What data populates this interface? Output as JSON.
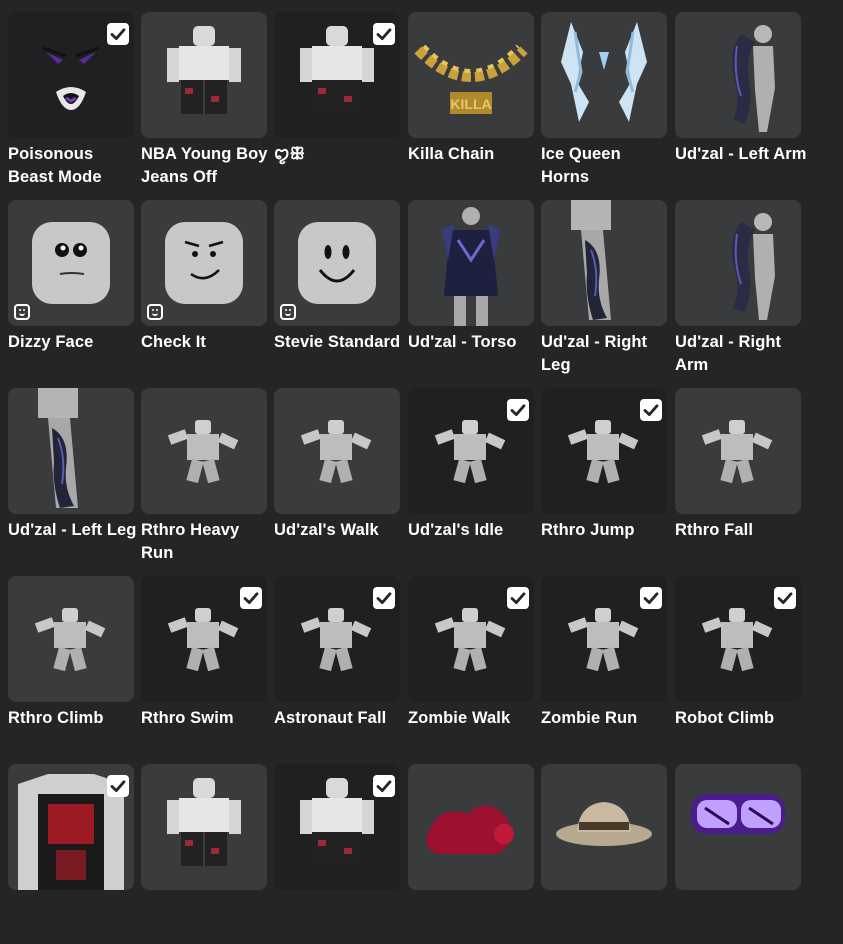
{
  "colors": {
    "page_bg": "#232527",
    "tile_bg": "#393b3d",
    "tile_dark_bg": "#1f2022",
    "text": "#ffffff",
    "check_bg": "#ffffff",
    "check_mark": "#232527"
  },
  "items": [
    {
      "name": "Poisonous Beast Mode",
      "selected": true,
      "badge": false,
      "dark": true,
      "art": "beast-face-icon"
    },
    {
      "name": "NBA Young Boy Jeans Off",
      "selected": false,
      "badge": false,
      "dark": false,
      "art": "avatar-pants-icon"
    },
    {
      "name": "ꨄ︎ꕥ",
      "selected": true,
      "badge": false,
      "dark": true,
      "art": "avatar-pants-icon"
    },
    {
      "name": "Killa Chain",
      "selected": false,
      "badge": false,
      "dark": false,
      "art": "gold-chain-icon"
    },
    {
      "name": "Ice Queen Horns",
      "selected": false,
      "badge": false,
      "dark": false,
      "art": "ice-horns-icon"
    },
    {
      "name": "Ud'zal - Left Arm",
      "selected": false,
      "badge": false,
      "dark": false,
      "art": "mannequin-arm-icon"
    },
    {
      "name": "Dizzy Face",
      "selected": false,
      "badge": true,
      "dark": false,
      "art": "face-dizzy-icon"
    },
    {
      "name": "Check It",
      "selected": false,
      "badge": true,
      "dark": false,
      "art": "face-smirk-icon"
    },
    {
      "name": "Stevie Standard",
      "selected": false,
      "badge": true,
      "dark": false,
      "art": "face-smile-icon"
    },
    {
      "name": "Ud'zal - Torso",
      "selected": false,
      "badge": false,
      "dark": false,
      "art": "armored-torso-icon"
    },
    {
      "name": "Ud'zal - Right Leg",
      "selected": false,
      "badge": false,
      "dark": false,
      "art": "mannequin-leg-icon"
    },
    {
      "name": "Ud'zal - Right Arm",
      "selected": false,
      "badge": false,
      "dark": false,
      "art": "mannequin-arm-icon"
    },
    {
      "name": "Ud'zal - Left Leg",
      "selected": false,
      "badge": false,
      "dark": false,
      "art": "mannequin-leg-icon"
    },
    {
      "name": "Rthro Heavy Run",
      "selected": false,
      "badge": false,
      "dark": false,
      "art": "animation-figure-icon"
    },
    {
      "name": "Ud'zal's Walk",
      "selected": false,
      "badge": false,
      "dark": false,
      "art": "animation-figure-icon"
    },
    {
      "name": "Ud'zal's Idle",
      "selected": true,
      "badge": false,
      "dark": true,
      "art": "animation-figure-icon"
    },
    {
      "name": "Rthro Jump",
      "selected": true,
      "badge": false,
      "dark": true,
      "art": "animation-figure-icon"
    },
    {
      "name": "Rthro Fall",
      "selected": false,
      "badge": false,
      "dark": false,
      "art": "animation-figure-icon"
    },
    {
      "name": "Rthro Climb",
      "selected": false,
      "badge": false,
      "dark": false,
      "art": "animation-figure-icon"
    },
    {
      "name": "Rthro Swim",
      "selected": true,
      "badge": false,
      "dark": true,
      "art": "animation-figure-icon"
    },
    {
      "name": "Astronaut Fall",
      "selected": true,
      "badge": false,
      "dark": true,
      "art": "animation-figure-icon"
    },
    {
      "name": "Zombie Walk",
      "selected": true,
      "badge": false,
      "dark": true,
      "art": "animation-figure-icon"
    },
    {
      "name": "Zombie Run",
      "selected": true,
      "badge": false,
      "dark": true,
      "art": "animation-figure-icon"
    },
    {
      "name": "Robot Climb",
      "selected": true,
      "badge": false,
      "dark": true,
      "art": "animation-figure-icon"
    },
    {
      "name": "",
      "selected": true,
      "badge": false,
      "dark": false,
      "art": "tshirt-icon"
    },
    {
      "name": "",
      "selected": false,
      "badge": false,
      "dark": false,
      "art": "avatar-pants-icon"
    },
    {
      "name": "",
      "selected": true,
      "badge": false,
      "dark": true,
      "art": "avatar-pants-icon"
    },
    {
      "name": "",
      "selected": false,
      "badge": false,
      "dark": false,
      "art": "red-hat-icon"
    },
    {
      "name": "",
      "selected": false,
      "badge": false,
      "dark": false,
      "art": "fedora-hat-icon"
    },
    {
      "name": "",
      "selected": false,
      "badge": false,
      "dark": false,
      "art": "neon-glasses-icon"
    }
  ]
}
